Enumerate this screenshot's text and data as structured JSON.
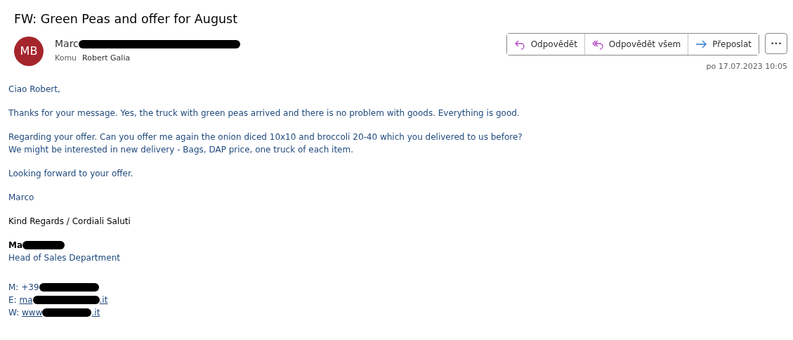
{
  "subject": "FW: Green Peas and offer for August",
  "sender": {
    "initials": "MB",
    "name": [
      {
        "kind": "text",
        "text": "Marc"
      },
      {
        "kind": "redaction"
      }
    ],
    "to_label": "Komu",
    "to": "Robert Galia"
  },
  "actions": [
    {
      "kind": "reply",
      "label": "Odpovědět"
    },
    {
      "kind": "reply_all",
      "label": "Odpovědět všem"
    },
    {
      "kind": "forward",
      "label": "Přeposlat"
    }
  ],
  "more_label": "•••",
  "date": "po 17.07.2023 10:05",
  "body": [
    {
      "kind": "para",
      "lines": [
        "Ciao Robert,"
      ]
    },
    {
      "kind": "para",
      "lines": [
        "Thanks for your message. Yes, the truck with green peas arrived and there is no problem with goods. Everything is good."
      ]
    },
    {
      "kind": "para",
      "lines": [
        "Regarding your offer. Can you offer me again the onion diced 10x10 and broccoli 20-40 which you delivered to us before?",
        "We might be interested in new delivery - Bags, DAP price, one truck of each item."
      ]
    },
    {
      "kind": "para",
      "lines": [
        "Looking forward to your offer."
      ]
    },
    {
      "kind": "para",
      "lines": [
        "Marco"
      ]
    },
    {
      "kind": "closing",
      "lines": [
        "Kind Regards / Cordiali Saluti"
      ]
    }
  ],
  "signature": {
    "name": [
      {
        "kind": "text",
        "text": "Ma"
      },
      {
        "kind": "redaction"
      }
    ],
    "role": "Head of Sales Department",
    "contacts": [
      {
        "label": "M: ",
        "kind": "text",
        "parts": [
          {
            "kind": "text",
            "text": "+39"
          },
          {
            "kind": "redaction"
          }
        ]
      },
      {
        "label": "E: ",
        "kind": "link",
        "parts": [
          {
            "kind": "text",
            "text": "ma"
          },
          {
            "kind": "redaction"
          },
          {
            "kind": "text",
            "text": ".it"
          }
        ]
      },
      {
        "label": "W: ",
        "kind": "link",
        "parts": [
          {
            "kind": "text",
            "text": "www"
          },
          {
            "kind": "redaction"
          },
          {
            "kind": "text",
            "text": ".it"
          }
        ]
      }
    ]
  }
}
